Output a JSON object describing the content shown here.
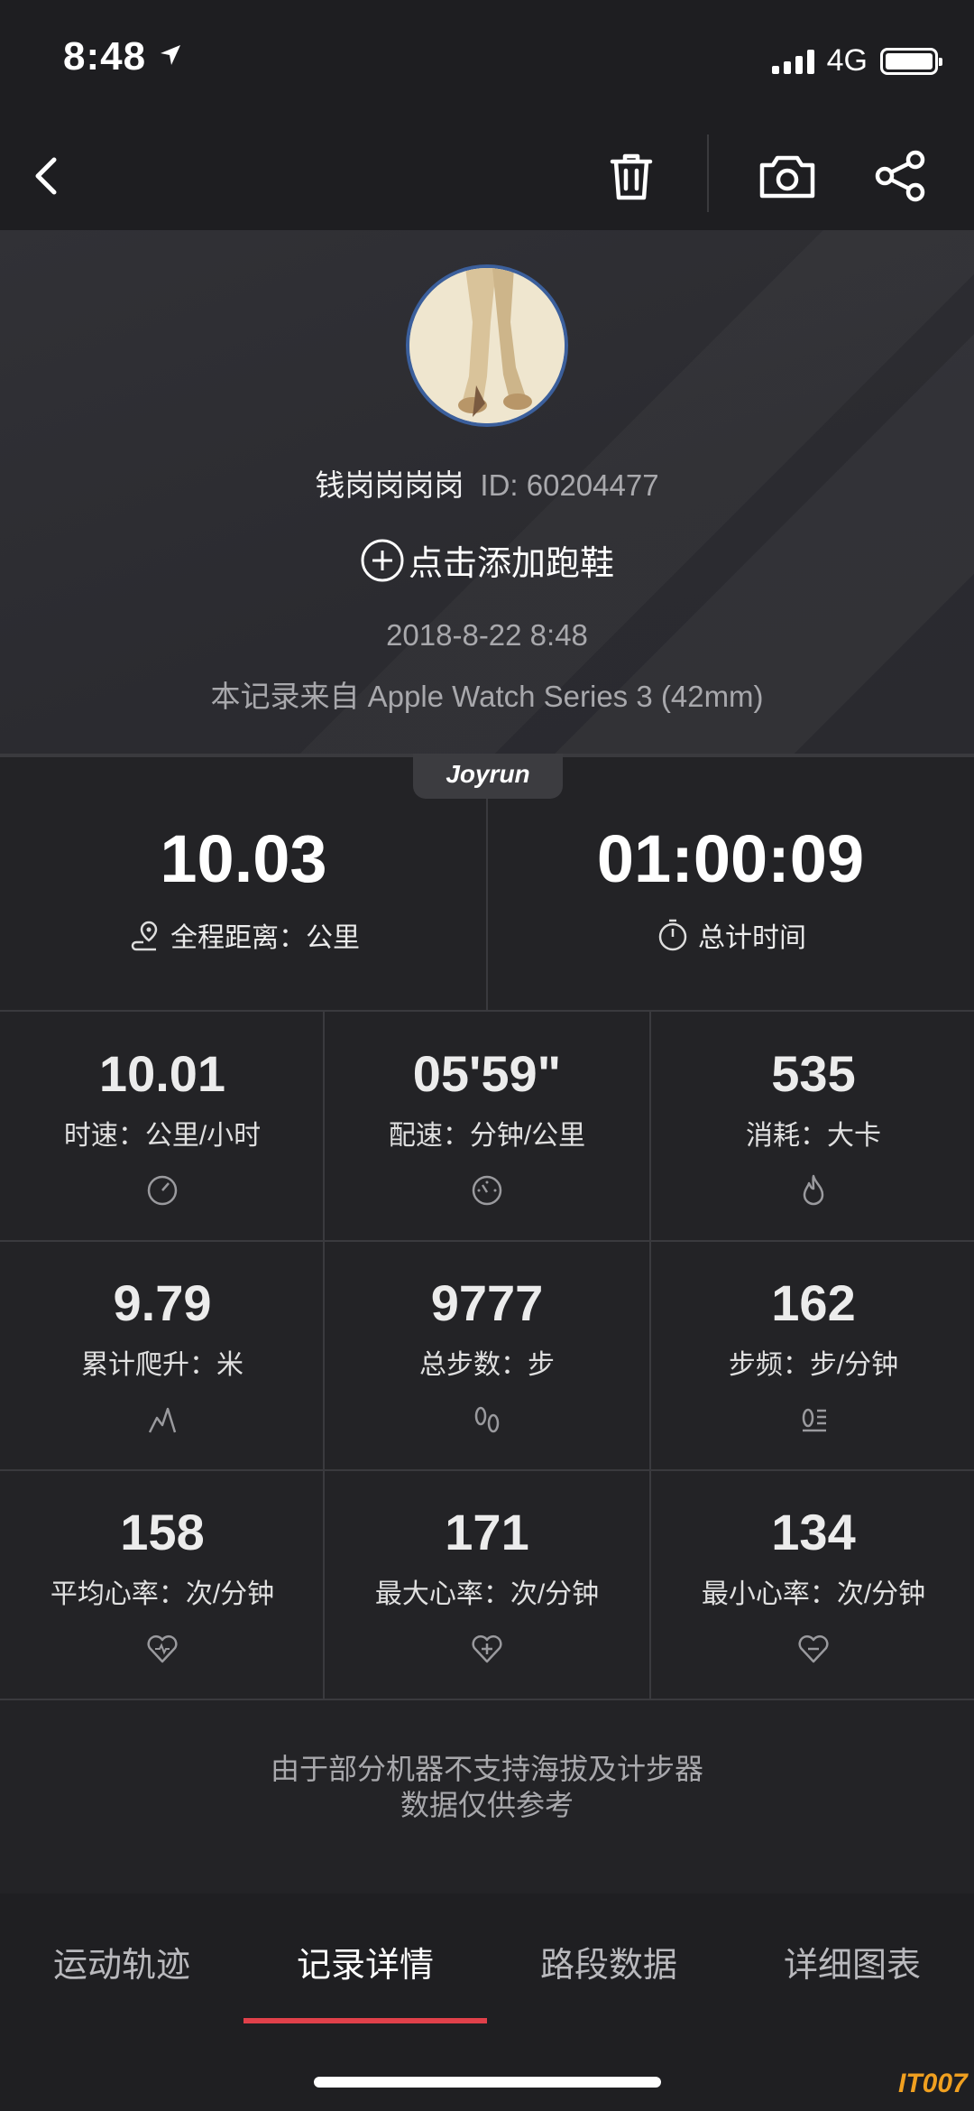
{
  "status_bar": {
    "time": "8:48",
    "network": "4G"
  },
  "profile": {
    "username": "钱岗岗岗岗",
    "user_id": "ID: 60204477",
    "add_shoes": "点击添加跑鞋",
    "date": "2018-8-22 8:48",
    "source": "本记录来自 Apple Watch Series 3 (42mm)"
  },
  "brand_tab": "Joyrun",
  "main_stats": [
    {
      "value": "10.03",
      "label": "全程距离：公里",
      "icon": "route-icon"
    },
    {
      "value": "01:00:09",
      "label": "总计时间",
      "icon": "stopwatch-icon"
    }
  ],
  "grid_stats": [
    {
      "value": "10.01",
      "label": "时速：公里/小时",
      "icon": "speedometer-icon"
    },
    {
      "value": "05'59\"",
      "label": "配速：分钟/公里",
      "icon": "pace-gauge-icon"
    },
    {
      "value": "535",
      "label": "消耗：大卡",
      "icon": "flame-icon"
    },
    {
      "value": "9.79",
      "label": "累计爬升：米",
      "icon": "climb-icon"
    },
    {
      "value": "9777",
      "label": "总步数：步",
      "icon": "footprints-icon"
    },
    {
      "value": "162",
      "label": "步频：步/分钟",
      "icon": "cadence-icon"
    },
    {
      "value": "158",
      "label": "平均心率：次/分钟",
      "icon": "heart-avg-icon"
    },
    {
      "value": "171",
      "label": "最大心率：次/分钟",
      "icon": "heart-max-icon"
    },
    {
      "value": "134",
      "label": "最小心率：次/分钟",
      "icon": "heart-min-icon"
    }
  ],
  "disclaimer": {
    "line1": "由于部分机器不支持海拔及计步器",
    "line2": "数据仅供参考"
  },
  "tabs": [
    {
      "label": "运动轨迹"
    },
    {
      "label": "记录详情",
      "active": true
    },
    {
      "label": "路段数据"
    },
    {
      "label": "详细图表"
    }
  ],
  "watermark": "IT007",
  "colors": {
    "accent": "#e0404a",
    "background": "#232326",
    "avatar_border": "#3b5f9c"
  }
}
